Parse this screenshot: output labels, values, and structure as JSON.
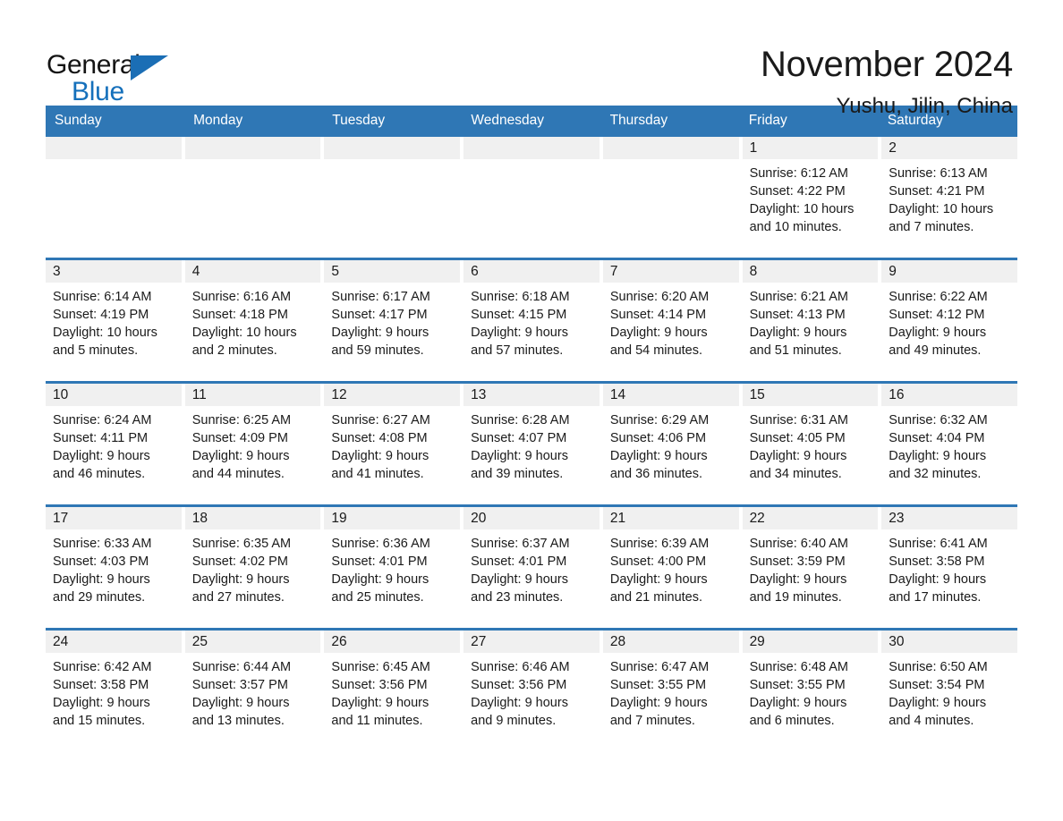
{
  "logo": {
    "word1": "General",
    "word2": "Blue",
    "triangle_color": "#1b6eb5",
    "blue_color": "#1570bb"
  },
  "header": {
    "month_title": "November 2024",
    "location": "Yushu, Jilin, China"
  },
  "colors": {
    "header_band": "#2f77b5",
    "day_band": "#f0f0f0",
    "row_rule": "#2f77b5",
    "text": "#1a1a1a"
  },
  "weekdays": [
    "Sunday",
    "Monday",
    "Tuesday",
    "Wednesday",
    "Thursday",
    "Friday",
    "Saturday"
  ],
  "weeks": [
    [
      {
        "day": "",
        "empty": true,
        "lines": []
      },
      {
        "day": "",
        "empty": true,
        "lines": []
      },
      {
        "day": "",
        "empty": true,
        "lines": []
      },
      {
        "day": "",
        "empty": true,
        "lines": []
      },
      {
        "day": "",
        "empty": true,
        "lines": []
      },
      {
        "day": "1",
        "sunrise": "Sunrise: 6:12 AM",
        "sunset": "Sunset: 4:22 PM",
        "daylight": "Daylight: 10 hours and 10 minutes."
      },
      {
        "day": "2",
        "sunrise": "Sunrise: 6:13 AM",
        "sunset": "Sunset: 4:21 PM",
        "daylight": "Daylight: 10 hours and 7 minutes."
      }
    ],
    [
      {
        "day": "3",
        "sunrise": "Sunrise: 6:14 AM",
        "sunset": "Sunset: 4:19 PM",
        "daylight": "Daylight: 10 hours and 5 minutes."
      },
      {
        "day": "4",
        "sunrise": "Sunrise: 6:16 AM",
        "sunset": "Sunset: 4:18 PM",
        "daylight": "Daylight: 10 hours and 2 minutes."
      },
      {
        "day": "5",
        "sunrise": "Sunrise: 6:17 AM",
        "sunset": "Sunset: 4:17 PM",
        "daylight": "Daylight: 9 hours and 59 minutes."
      },
      {
        "day": "6",
        "sunrise": "Sunrise: 6:18 AM",
        "sunset": "Sunset: 4:15 PM",
        "daylight": "Daylight: 9 hours and 57 minutes."
      },
      {
        "day": "7",
        "sunrise": "Sunrise: 6:20 AM",
        "sunset": "Sunset: 4:14 PM",
        "daylight": "Daylight: 9 hours and 54 minutes."
      },
      {
        "day": "8",
        "sunrise": "Sunrise: 6:21 AM",
        "sunset": "Sunset: 4:13 PM",
        "daylight": "Daylight: 9 hours and 51 minutes."
      },
      {
        "day": "9",
        "sunrise": "Sunrise: 6:22 AM",
        "sunset": "Sunset: 4:12 PM",
        "daylight": "Daylight: 9 hours and 49 minutes."
      }
    ],
    [
      {
        "day": "10",
        "sunrise": "Sunrise: 6:24 AM",
        "sunset": "Sunset: 4:11 PM",
        "daylight": "Daylight: 9 hours and 46 minutes."
      },
      {
        "day": "11",
        "sunrise": "Sunrise: 6:25 AM",
        "sunset": "Sunset: 4:09 PM",
        "daylight": "Daylight: 9 hours and 44 minutes."
      },
      {
        "day": "12",
        "sunrise": "Sunrise: 6:27 AM",
        "sunset": "Sunset: 4:08 PM",
        "daylight": "Daylight: 9 hours and 41 minutes."
      },
      {
        "day": "13",
        "sunrise": "Sunrise: 6:28 AM",
        "sunset": "Sunset: 4:07 PM",
        "daylight": "Daylight: 9 hours and 39 minutes."
      },
      {
        "day": "14",
        "sunrise": "Sunrise: 6:29 AM",
        "sunset": "Sunset: 4:06 PM",
        "daylight": "Daylight: 9 hours and 36 minutes."
      },
      {
        "day": "15",
        "sunrise": "Sunrise: 6:31 AM",
        "sunset": "Sunset: 4:05 PM",
        "daylight": "Daylight: 9 hours and 34 minutes."
      },
      {
        "day": "16",
        "sunrise": "Sunrise: 6:32 AM",
        "sunset": "Sunset: 4:04 PM",
        "daylight": "Daylight: 9 hours and 32 minutes."
      }
    ],
    [
      {
        "day": "17",
        "sunrise": "Sunrise: 6:33 AM",
        "sunset": "Sunset: 4:03 PM",
        "daylight": "Daylight: 9 hours and 29 minutes."
      },
      {
        "day": "18",
        "sunrise": "Sunrise: 6:35 AM",
        "sunset": "Sunset: 4:02 PM",
        "daylight": "Daylight: 9 hours and 27 minutes."
      },
      {
        "day": "19",
        "sunrise": "Sunrise: 6:36 AM",
        "sunset": "Sunset: 4:01 PM",
        "daylight": "Daylight: 9 hours and 25 minutes."
      },
      {
        "day": "20",
        "sunrise": "Sunrise: 6:37 AM",
        "sunset": "Sunset: 4:01 PM",
        "daylight": "Daylight: 9 hours and 23 minutes."
      },
      {
        "day": "21",
        "sunrise": "Sunrise: 6:39 AM",
        "sunset": "Sunset: 4:00 PM",
        "daylight": "Daylight: 9 hours and 21 minutes."
      },
      {
        "day": "22",
        "sunrise": "Sunrise: 6:40 AM",
        "sunset": "Sunset: 3:59 PM",
        "daylight": "Daylight: 9 hours and 19 minutes."
      },
      {
        "day": "23",
        "sunrise": "Sunrise: 6:41 AM",
        "sunset": "Sunset: 3:58 PM",
        "daylight": "Daylight: 9 hours and 17 minutes."
      }
    ],
    [
      {
        "day": "24",
        "sunrise": "Sunrise: 6:42 AM",
        "sunset": "Sunset: 3:58 PM",
        "daylight": "Daylight: 9 hours and 15 minutes."
      },
      {
        "day": "25",
        "sunrise": "Sunrise: 6:44 AM",
        "sunset": "Sunset: 3:57 PM",
        "daylight": "Daylight: 9 hours and 13 minutes."
      },
      {
        "day": "26",
        "sunrise": "Sunrise: 6:45 AM",
        "sunset": "Sunset: 3:56 PM",
        "daylight": "Daylight: 9 hours and 11 minutes."
      },
      {
        "day": "27",
        "sunrise": "Sunrise: 6:46 AM",
        "sunset": "Sunset: 3:56 PM",
        "daylight": "Daylight: 9 hours and 9 minutes."
      },
      {
        "day": "28",
        "sunrise": "Sunrise: 6:47 AM",
        "sunset": "Sunset: 3:55 PM",
        "daylight": "Daylight: 9 hours and 7 minutes."
      },
      {
        "day": "29",
        "sunrise": "Sunrise: 6:48 AM",
        "sunset": "Sunset: 3:55 PM",
        "daylight": "Daylight: 9 hours and 6 minutes."
      },
      {
        "day": "30",
        "sunrise": "Sunrise: 6:50 AM",
        "sunset": "Sunset: 3:54 PM",
        "daylight": "Daylight: 9 hours and 4 minutes."
      }
    ]
  ]
}
